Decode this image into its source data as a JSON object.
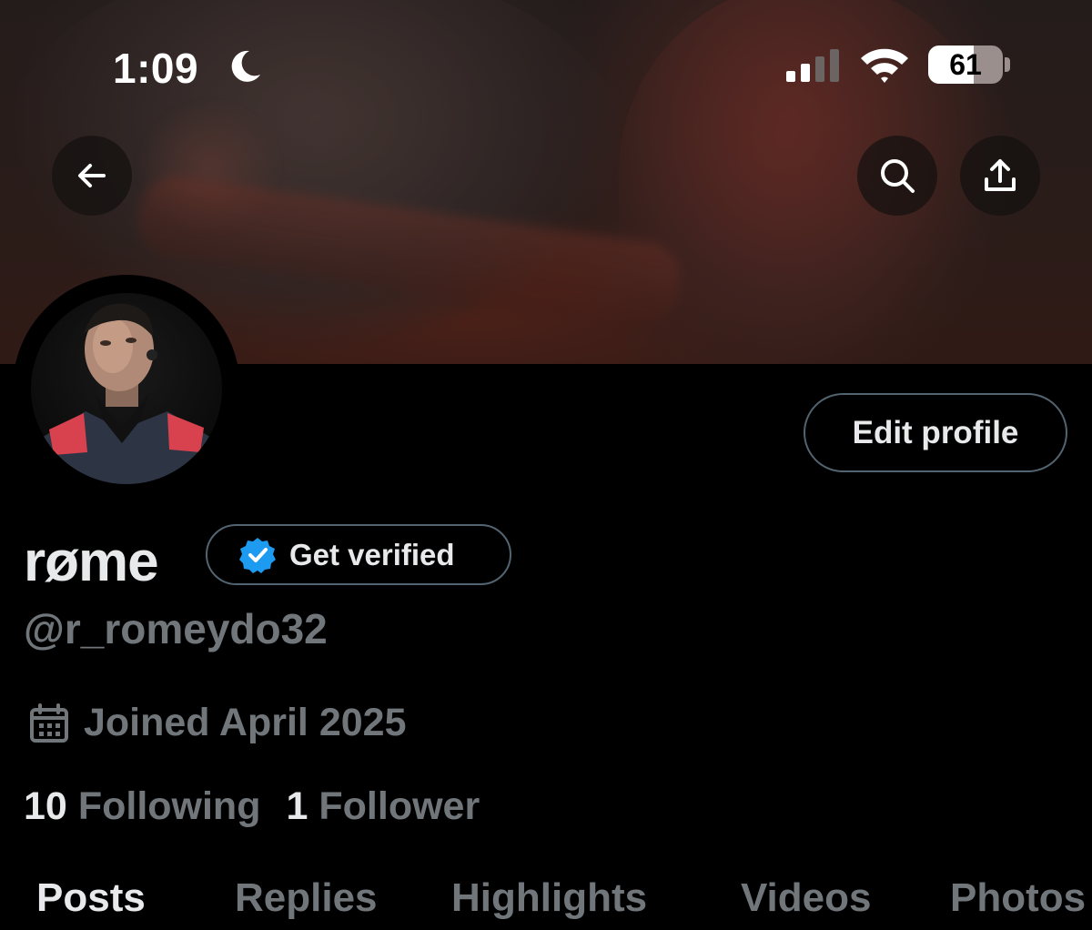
{
  "status_bar": {
    "time": "1:09",
    "battery_percent": "61",
    "battery_level": 0.61,
    "signal_bars": 2
  },
  "header": {
    "back_icon": "arrow-left-icon",
    "search_icon": "search-icon",
    "share_icon": "share-icon"
  },
  "profile": {
    "display_name": "røme",
    "get_verified_label": "Get verified",
    "handle": "@r_romeydo32",
    "joined": "Joined April 2025",
    "edit_profile_label": "Edit profile",
    "following_count": "10",
    "following_label": "Following",
    "followers_count": "1",
    "followers_label": "Follower"
  },
  "tabs": [
    {
      "label": "Posts",
      "active": true
    },
    {
      "label": "Replies",
      "active": false
    },
    {
      "label": "Highlights",
      "active": false
    },
    {
      "label": "Videos",
      "active": false
    },
    {
      "label": "Photos",
      "active": false
    }
  ],
  "colors": {
    "background": "#000000",
    "primary_text": "#e7e9ea",
    "secondary_text": "#71767b",
    "border": "#536471",
    "verified_blue": "#1d9bf0"
  }
}
